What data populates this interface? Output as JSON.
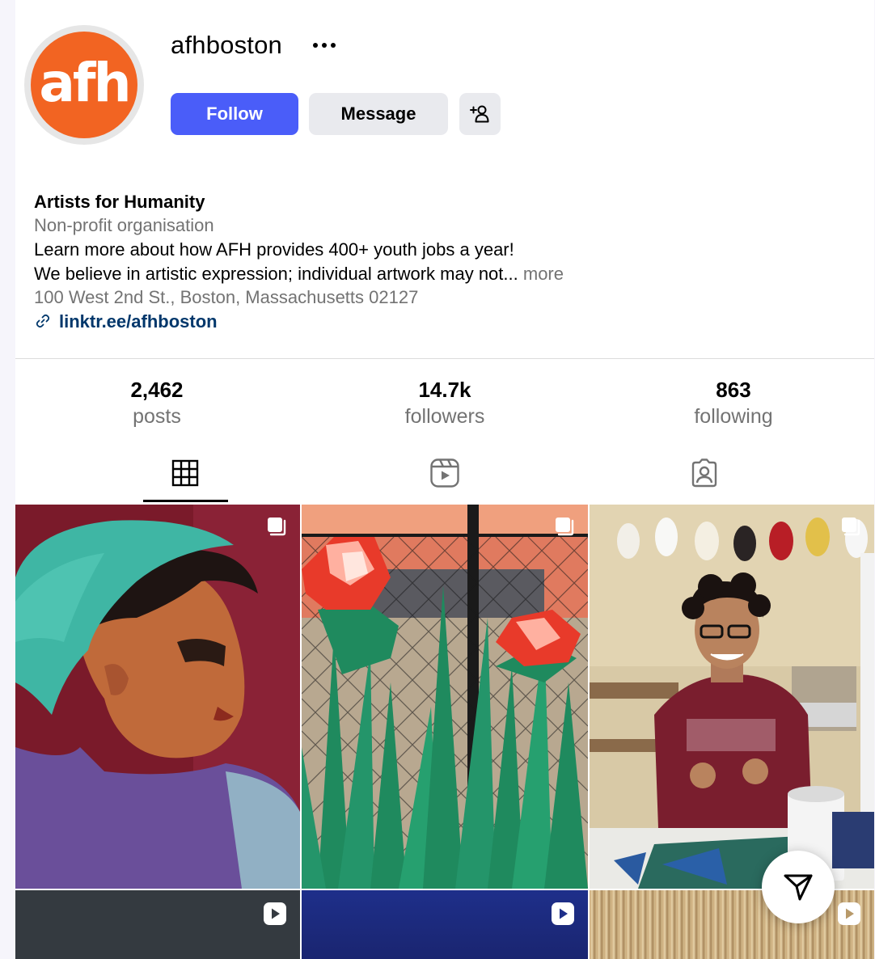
{
  "profile": {
    "avatar_text": "afh",
    "username": "afhboston",
    "follow_label": "Follow",
    "message_label": "Message",
    "name": "Artists for Humanity",
    "category": "Non-profit organisation",
    "bio_line1": "Learn more about how AFH provides 400+ youth jobs a year!",
    "bio_line2": "We believe in artistic expression; individual artwork may not...",
    "more_label": "more",
    "address": "100 West 2nd St., Boston, Massachusetts 02127",
    "link": "linktr.ee/afhboston"
  },
  "stats": {
    "posts_count": "2,462",
    "posts_label": "posts",
    "followers_count": "14.7k",
    "followers_label": "followers",
    "following_count": "863",
    "following_label": "following"
  },
  "tabs": [
    {
      "icon": "grid-icon",
      "active": true
    },
    {
      "icon": "reels-icon",
      "active": false
    },
    {
      "icon": "tagged-icon",
      "active": false
    }
  ],
  "colors": {
    "accent": "#4a5df9",
    "avatar_bg": "#f26422",
    "link": "#00376b",
    "secondary_text": "#737373"
  }
}
